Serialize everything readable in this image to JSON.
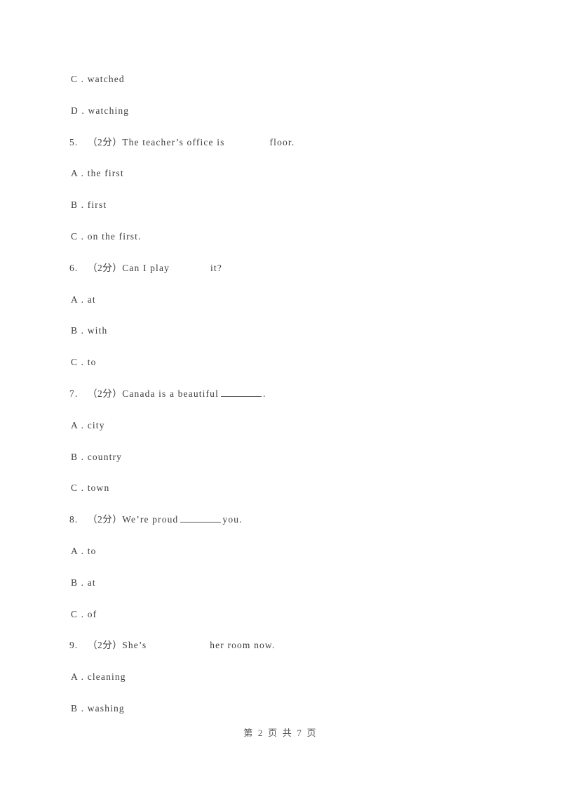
{
  "document": {
    "type": "exam-paper",
    "language": "en-zh",
    "page_background": "#ffffff",
    "text_color": "#3d3d3d"
  },
  "lines": [
    {
      "id": "l1",
      "kind": "option",
      "label": "C .",
      "text": "watched",
      "blank": "none"
    },
    {
      "id": "l2",
      "kind": "option",
      "label": "D .",
      "text": "watching",
      "blank": "none"
    },
    {
      "id": "l3",
      "kind": "question",
      "num": "5.",
      "marks": "（2分）",
      "pre": "The teacher’s office is",
      "post": "floor.",
      "blank": "gap-md"
    },
    {
      "id": "l4",
      "kind": "option",
      "label": "A .",
      "text": "the first",
      "blank": "none"
    },
    {
      "id": "l5",
      "kind": "option",
      "label": "B .",
      "text": "first",
      "blank": "none"
    },
    {
      "id": "l6",
      "kind": "option",
      "label": "C .",
      "text": "on the first.",
      "blank": "none"
    },
    {
      "id": "l7",
      "kind": "question",
      "num": "6.",
      "marks": "（2分）",
      "pre": "Can I play",
      "post": "it?",
      "blank": "gap-sm"
    },
    {
      "id": "l8",
      "kind": "option",
      "label": "A .",
      "text": "at",
      "blank": "none"
    },
    {
      "id": "l9",
      "kind": "option",
      "label": "B .",
      "text": "with",
      "blank": "none"
    },
    {
      "id": "l10",
      "kind": "option",
      "label": "C .",
      "text": "to",
      "blank": "none"
    },
    {
      "id": "l11",
      "kind": "question",
      "num": "7.",
      "marks": "（2分）",
      "pre": "Canada is a beautiful",
      "post": ".",
      "blank": "underline"
    },
    {
      "id": "l12",
      "kind": "option",
      "label": "A .",
      "text": "city",
      "blank": "none"
    },
    {
      "id": "l13",
      "kind": "option",
      "label": "B .",
      "text": "country",
      "blank": "none"
    },
    {
      "id": "l14",
      "kind": "option",
      "label": "C .",
      "text": "town",
      "blank": "none"
    },
    {
      "id": "l15",
      "kind": "question",
      "num": "8.",
      "marks": "（2分）",
      "pre": "We’re proud",
      "post": "you.",
      "blank": "underline"
    },
    {
      "id": "l16",
      "kind": "option",
      "label": "A .",
      "text": "to",
      "blank": "none"
    },
    {
      "id": "l17",
      "kind": "option",
      "label": "B .",
      "text": "at",
      "blank": "none"
    },
    {
      "id": "l18",
      "kind": "option",
      "label": "C .",
      "text": "of",
      "blank": "none"
    },
    {
      "id": "l19",
      "kind": "question",
      "num": "9.",
      "marks": "（2分）",
      "pre": "She’s",
      "post": "her room now.",
      "blank": "gap-lg"
    },
    {
      "id": "l20",
      "kind": "option",
      "label": "A .",
      "text": "cleaning",
      "blank": "none"
    },
    {
      "id": "l21",
      "kind": "option",
      "label": "B .",
      "text": "washing",
      "blank": "none"
    }
  ],
  "footer": {
    "text": "第 2 页 共 7 页",
    "current_page": "2",
    "total_pages": "7"
  }
}
